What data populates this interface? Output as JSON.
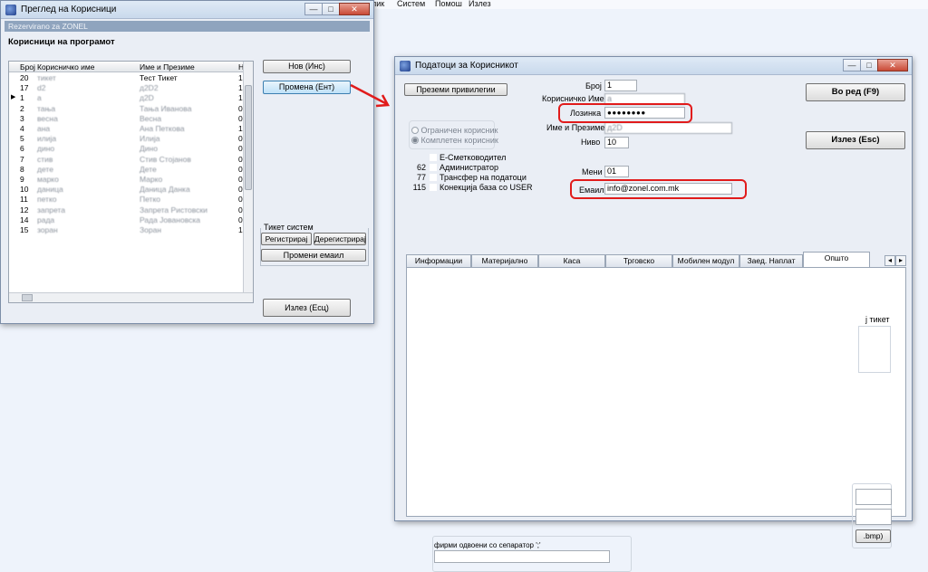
{
  "background_menu": [
    "лик",
    "Систем",
    "Помош",
    "Излез"
  ],
  "users_window": {
    "title": "Преглед на Корисници",
    "reserved_label": "Rezervirano za ZONEL",
    "section_title": "Корисници на програмот",
    "columns": [
      "Број",
      "Корисничко име",
      "Име и Презиме",
      "Н"
    ],
    "rows": [
      {
        "num": "20",
        "user": "тикет",
        "name": "Тест Тикет",
        "n": "1"
      },
      {
        "num": "17",
        "user": "d2",
        "name": "д2D2",
        "n": "1"
      },
      {
        "num": "1",
        "user": "a",
        "name": "д2D",
        "n": "1"
      },
      {
        "num": "2",
        "user": "тања",
        "name": "Тања Ивановa",
        "n": "0"
      },
      {
        "num": "3",
        "user": "весна",
        "name": "Весна",
        "n": "0"
      },
      {
        "num": "4",
        "user": "ана",
        "name": "Ана Петкова",
        "n": "1"
      },
      {
        "num": "5",
        "user": "илија",
        "name": "Илија",
        "n": "0"
      },
      {
        "num": "6",
        "user": "дино",
        "name": "Дино",
        "n": "0"
      },
      {
        "num": "7",
        "user": "стив",
        "name": "Стив Стојанов",
        "n": "0"
      },
      {
        "num": "8",
        "user": "дете",
        "name": "Дете",
        "n": "0"
      },
      {
        "num": "9",
        "user": "марко",
        "name": "Марко",
        "n": "0"
      },
      {
        "num": "10",
        "user": "даница",
        "name": "Даница Данка",
        "n": "0"
      },
      {
        "num": "11",
        "user": "петко",
        "name": "Петко",
        "n": "0"
      },
      {
        "num": "12",
        "user": "запрета",
        "name": "Запрета Ристовски",
        "n": "0"
      },
      {
        "num": "14",
        "user": "рада",
        "name": "Рада Јовановска",
        "n": "0"
      },
      {
        "num": "15",
        "user": "зоран",
        "name": "Зоран",
        "n": "1"
      }
    ],
    "btn_new": "Нов (Инс)",
    "btn_edit": "Промена (Ент)",
    "ticket_group": "Тикет систем",
    "btn_register": "Регистрирај",
    "btn_unregister": "Дерегистрирај",
    "btn_change_email": "Промени емаил",
    "btn_exit": "Излез (Есц)"
  },
  "user_data_window": {
    "title": "Податоци за Корисникот",
    "btn_inherit": "Преземи привилегии",
    "lbl_number": "Број",
    "val_number": "1",
    "lbl_username": "Корисничко Име",
    "val_username": "a",
    "lbl_password": "Лозинка",
    "val_password": "●●●●●●●●",
    "lbl_fullname": "Име и Презиме",
    "val_fullname": "д2D",
    "lbl_level": "Ниво",
    "val_level": "10",
    "lbl_menu": "Мени",
    "val_menu": "01",
    "lbl_email": "Емаил",
    "val_email": "info@zonel.com.mk",
    "radio_limited": "Ограничен корисник",
    "radio_full": "Комплетен корисник",
    "roles": [
      {
        "code": "",
        "label": "Е-Сметководител"
      },
      {
        "code": "62",
        "label": "Администратор"
      },
      {
        "code": "77",
        "label": "Трансфер на податоци"
      },
      {
        "code": "115",
        "label": "Конекција база со USER"
      }
    ],
    "btn_ok": "Во ред (F9)",
    "btn_exit": "Излез (Esc)",
    "tabs": [
      "Информации",
      "Материјално",
      "Каса",
      "Трговско",
      "Мобилен модул",
      "Заед. Наплат",
      "Општо"
    ],
    "text_ticket": "ј тикет",
    "text_bmp": ".bmp)",
    "text_separator_note": "фирми одвоени со сепаратор ';'"
  }
}
